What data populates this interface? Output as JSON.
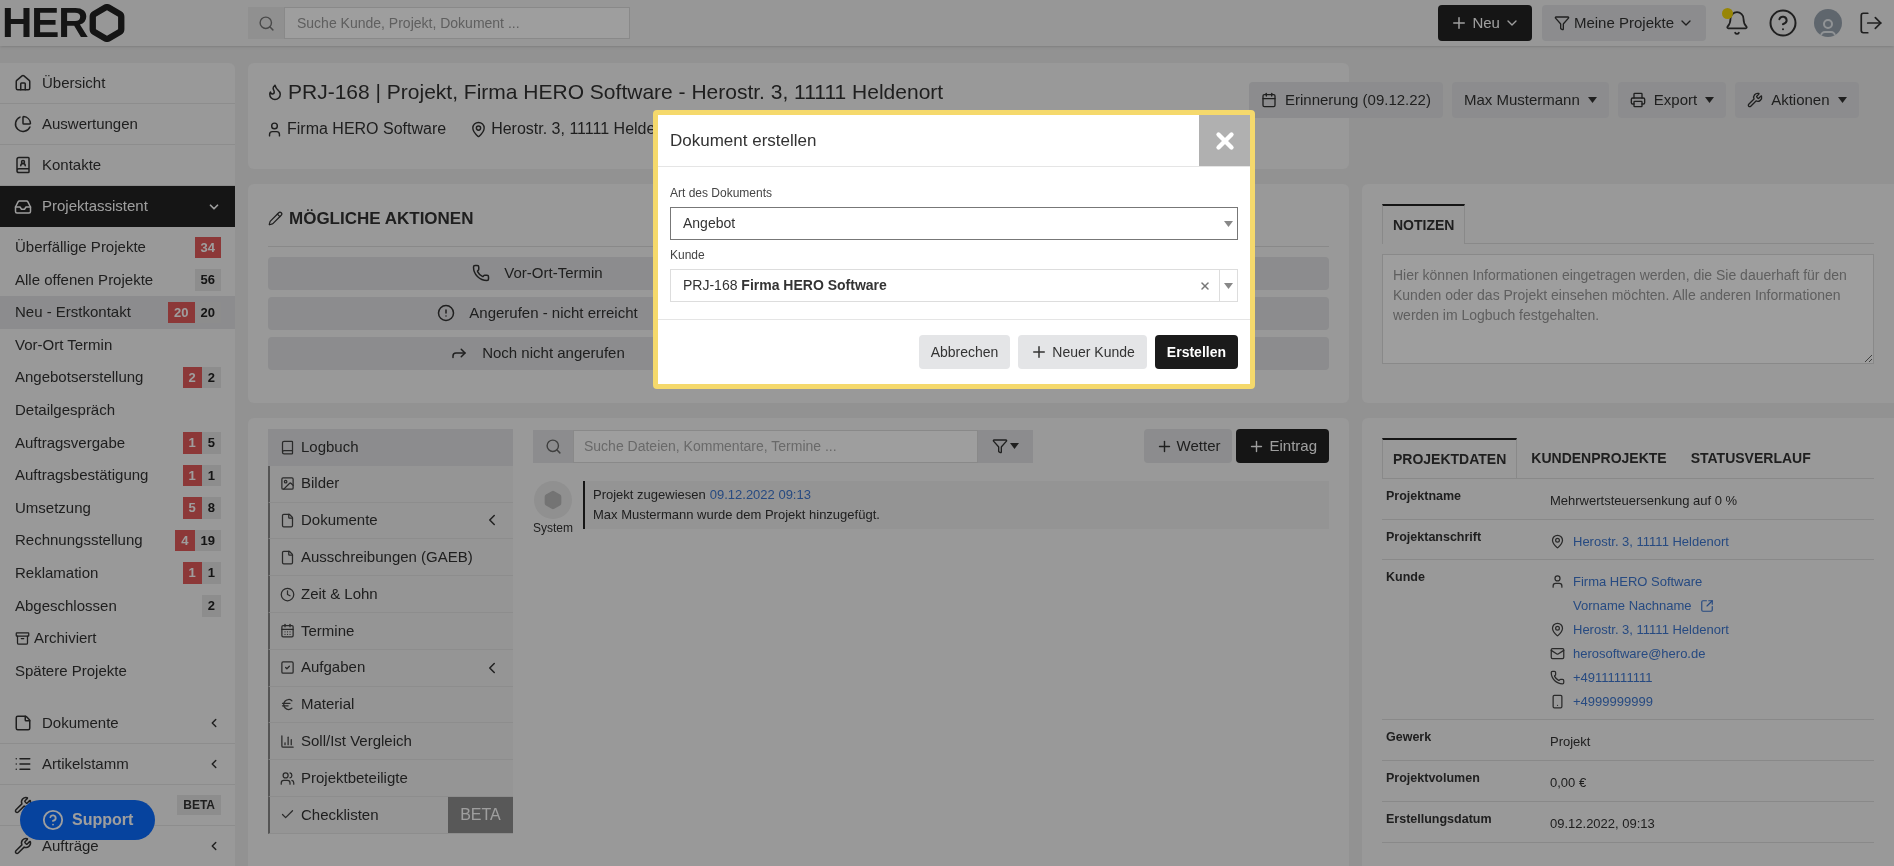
{
  "topbar": {
    "logo": "HER",
    "search": {
      "placeholder": "Suche Kunde, Projekt, Dokument ..."
    },
    "new_button": "Neu",
    "filter_button": "Meine Projekte",
    "notification": true
  },
  "sidebar": {
    "items": [
      {
        "kind": "link",
        "label": "Übersicht"
      },
      {
        "kind": "link",
        "label": "Auswertungen"
      },
      {
        "kind": "link",
        "label": "Kontakte"
      },
      {
        "kind": "group",
        "label": "Projektassistent",
        "expanded": true,
        "children": [
          {
            "kind": "stage",
            "label": "Überfällige Projekte",
            "overdue": "34",
            "selected": false
          },
          {
            "kind": "stage",
            "label": "Alle offenen Projekte",
            "count": "56",
            "selected": false
          },
          {
            "kind": "stage",
            "label": "Neu - Erstkontakt",
            "overdue": "20",
            "count": "20",
            "selected": true
          },
          {
            "kind": "stage",
            "label": "Vor-Ort Termin",
            "selected": false
          },
          {
            "kind": "stage",
            "label": "Angebotserstellung",
            "overdue": "2",
            "count": "2",
            "selected": false
          },
          {
            "kind": "stage",
            "label": "Detailgespräch",
            "selected": false
          },
          {
            "kind": "stage",
            "label": "Auftragsvergabe",
            "overdue": "1",
            "count": "5",
            "selected": false
          },
          {
            "kind": "stage",
            "label": "Auftragsbestätigung",
            "overdue": "1",
            "count": "1",
            "selected": false
          },
          {
            "kind": "stage",
            "label": "Umsetzung",
            "overdue": "5",
            "count": "8",
            "selected": false
          },
          {
            "kind": "stage",
            "label": "Rechnungsstellung",
            "overdue": "4",
            "count": "19",
            "selected": false
          },
          {
            "kind": "stage",
            "label": "Reklamation",
            "overdue": "1",
            "count": "1",
            "selected": false
          },
          {
            "kind": "stage",
            "label": "Abgeschlossen",
            "count": "2",
            "selected": false
          },
          {
            "kind": "archive",
            "label": "Archiviert",
            "selected": false
          },
          {
            "kind": "stage",
            "label": "Spätere Projekte",
            "selected": false
          }
        ]
      },
      {
        "kind": "link",
        "label": "Dokumente",
        "expanded": false
      },
      {
        "kind": "link",
        "label": "Artikelstamm",
        "expanded": false
      },
      {
        "kind": "link",
        "badge": "BETA"
      },
      {
        "kind": "link",
        "label": "Aufträge",
        "expanded": false
      }
    ]
  },
  "support_button": "Support",
  "header": {
    "title": "PRJ-168 | Projekt, Firma HERO Software - Herostr. 3, 11111 Heldenort",
    "customer": "Firma HERO Software",
    "address": "Herostr. 3, 11111 Helde",
    "buttons": [
      {
        "label": "Erinnerung (09.12.22)",
        "dropdown": false
      },
      {
        "label": "Max Mustermann",
        "dropdown": true
      },
      {
        "label": "Export",
        "dropdown": true
      },
      {
        "label": "Aktionen",
        "dropdown": true
      }
    ]
  },
  "actions": {
    "title": "MÖGLICHE AKTIONEN",
    "buttons": [
      "Vor-Ort-Termin",
      "Angerufen - nicht erreicht",
      "Noch nicht angerufen"
    ]
  },
  "logbook": {
    "menu": [
      {
        "label": "Logbuch",
        "selected": true
      },
      {
        "label": "Bilder",
        "selected": false
      },
      {
        "label": "Dokumente",
        "selected": false,
        "expanded": false
      },
      {
        "label": "Ausschreibungen (GAEB)",
        "selected": false
      },
      {
        "label": "Zeit & Lohn",
        "selected": false
      },
      {
        "label": "Termine",
        "selected": false
      },
      {
        "label": "Aufgaben",
        "selected": false,
        "expanded": false
      },
      {
        "label": "Material",
        "selected": false
      },
      {
        "label": "Soll/Ist Vergleich",
        "selected": false
      },
      {
        "label": "Projektbeteiligte",
        "selected": false
      },
      {
        "label": "Checklisten",
        "selected": false,
        "badge": "BETA"
      }
    ],
    "search": {
      "placeholder": "Suche Dateien, Kommentare, Termine ..."
    },
    "buttons": [
      {
        "label": "Wetter",
        "primary": false
      },
      {
        "label": "Eintrag",
        "primary": true
      }
    ],
    "entries": [
      {
        "author": "System",
        "event": "Projekt zugewiesen",
        "time": "09.12.2022 09:13",
        "text": "Max Mustermann wurde dem Projekt hinzugefügt."
      }
    ]
  },
  "notes": {
    "tabs": [
      {
        "label": "NOTIZEN",
        "selected": true
      }
    ],
    "placeholder": "Hier können Informationen eingetragen werden, die Sie dauerhaft für den Kunden oder das Projekt einsehen möchten. Alle anderen Informationen werden im Logbuch festgehalten."
  },
  "project_data": {
    "tabs": [
      {
        "label": "PROJEKTDATEN",
        "selected": true
      },
      {
        "label": "KUNDENPROJEKTE",
        "selected": false
      },
      {
        "label": "STATUSVERLAUF",
        "selected": false
      }
    ],
    "rows": [
      {
        "label": "Projektname",
        "lines": [
          {
            "kind": "text",
            "text": "Mehrwertsteuersenkung auf 0 %"
          }
        ]
      },
      {
        "label": "Projektanschrift",
        "lines": [
          {
            "kind": "address",
            "text": "Herostr. 3, 11111 Heldenort"
          }
        ]
      },
      {
        "label": "Kunde",
        "lines": [
          {
            "kind": "person",
            "text": "Firma HERO Software"
          },
          {
            "kind": "contact",
            "text": "Vorname Nachname"
          },
          {
            "kind": "address",
            "text": "Herostr. 3, 11111 Heldenort"
          },
          {
            "kind": "email",
            "text": "herosoftware@hero.de"
          },
          {
            "kind": "phone",
            "text": "+49111111111"
          },
          {
            "kind": "mobile",
            "text": "+4999999999"
          }
        ]
      },
      {
        "label": "Gewerk",
        "lines": [
          {
            "kind": "text",
            "text": "Projekt"
          }
        ]
      },
      {
        "label": "Projektvolumen",
        "lines": [
          {
            "kind": "text",
            "text": "0,00 €"
          }
        ]
      },
      {
        "label": "Erstellungsdatum",
        "lines": [
          {
            "kind": "text",
            "text": "09.12.2022, 09:13"
          }
        ]
      }
    ]
  },
  "modal": {
    "title": "Dokument erstellen",
    "fields": [
      {
        "kind": "select",
        "label": "Art des Dokuments",
        "value": "Angebot"
      },
      {
        "kind": "combo",
        "label": "Kunde",
        "value": "PRJ-168 **Firma HERO Software**"
      }
    ],
    "buttons": [
      {
        "kind": "secondary",
        "label": "Abbrechen"
      },
      {
        "kind": "add",
        "label": "Neuer Kunde"
      },
      {
        "kind": "primary",
        "label": "Erstellen"
      }
    ]
  }
}
